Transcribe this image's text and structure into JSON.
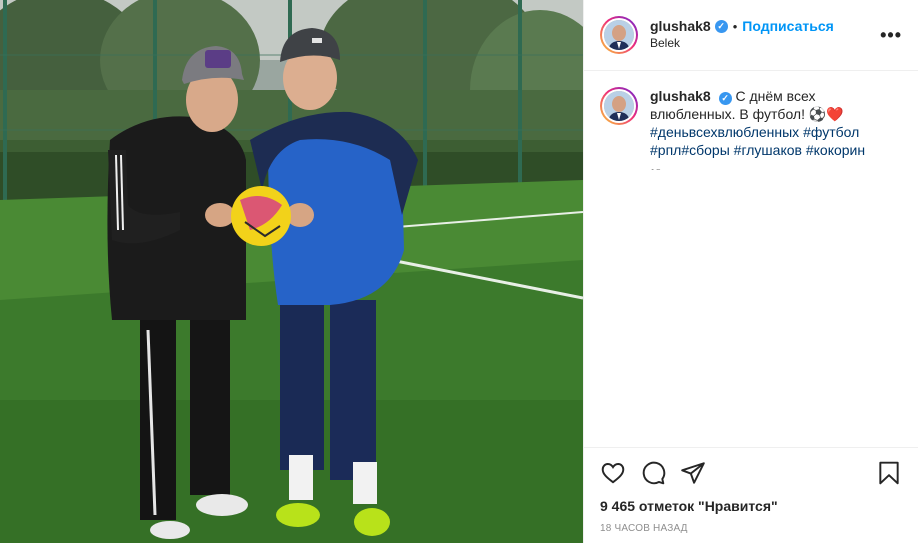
{
  "post": {
    "username": "glushak8",
    "follow_label": "Подписаться",
    "separator": "•",
    "location": "Belek",
    "more_label": "•••",
    "verified_glyph": "✓"
  },
  "caption": {
    "username": "glushak8",
    "text": "С днём всех влюбленных. В футбол! ⚽❤️",
    "hashtags": [
      "#деньвсехвлюбленных",
      "#футбол",
      "#рпл",
      "#сборы",
      "#глушаков",
      "#кокорин"
    ],
    "time_partial": "18 ч"
  },
  "actions": {
    "likes_text": "9 465 отметок \"Нравится\"",
    "time_ago": "18 часов назад"
  },
  "icons": {
    "like": "heart-icon",
    "comment": "comment-icon",
    "share": "share-icon",
    "save": "bookmark-icon",
    "verified": "verified-badge-icon"
  },
  "colors": {
    "accent": "#0095f6",
    "hashtag": "#00376b",
    "muted": "#8e8e8e",
    "verified": "#3897f0"
  }
}
